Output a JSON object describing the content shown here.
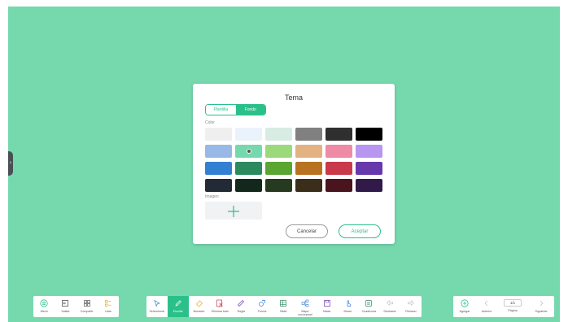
{
  "dialog": {
    "title": "Tema",
    "tabs": [
      "Plantilla",
      "Fondo"
    ],
    "active_tab": "Fondo",
    "color_label": "Color",
    "image_label": "Imagen",
    "cancel_label": "Cancelar",
    "accept_label": "Aceptar",
    "selected_color": "#76d9ae",
    "swatch_colors": [
      [
        "#efefef",
        "#eaf3fb",
        "#d7ece3",
        "#808080",
        "#2f2f2f",
        "#000000"
      ],
      [
        "#98b9e6",
        "#76d9ae",
        "#9cd97a",
        "#e2b283",
        "#ef8ba5",
        "#b795f1"
      ],
      [
        "#337fd2",
        "#2b8a5e",
        "#5ba532",
        "#b9721f",
        "#c8394a",
        "#6738ab"
      ],
      [
        "#222a35",
        "#13281d",
        "#263a1f",
        "#3a2d1a",
        "#4a141e",
        "#311a4a"
      ]
    ]
  },
  "toolbar_left": {
    "items": [
      {
        "label": "Menú",
        "icon": "menu-icon"
      },
      {
        "label": "Salida",
        "icon": "exit-icon"
      },
      {
        "label": "Compartir",
        "icon": "share-icon"
      },
      {
        "label": "Lista",
        "icon": "list-icon"
      }
    ]
  },
  "toolbar_center": {
    "items": [
      {
        "label": "Seleccionar",
        "icon": "select-icon"
      },
      {
        "label": "Escribir",
        "icon": "pen-icon"
      },
      {
        "label": "Borrador",
        "icon": "eraser-icon"
      },
      {
        "label": "Eliminar todo",
        "icon": "clear-all-icon"
      },
      {
        "label": "Regla",
        "icon": "ruler-icon"
      },
      {
        "label": "Forma",
        "icon": "shape-icon"
      },
      {
        "label": "Tabla",
        "icon": "table-icon"
      },
      {
        "label": "Mapa conceptual",
        "icon": "mindmap-icon"
      },
      {
        "label": "Notas",
        "icon": "notes-icon"
      },
      {
        "label": "Mover",
        "icon": "move-icon"
      },
      {
        "label": "Cuadrícula",
        "icon": "grid-icon"
      },
      {
        "label": "Deshacer",
        "icon": "undo-icon"
      },
      {
        "label": "Rehacer",
        "icon": "redo-icon"
      }
    ],
    "active": "Escribir"
  },
  "toolbar_right": {
    "add_label": "Agregar",
    "prev_label": "Anterior",
    "page_label": "Página",
    "page_value": "1/1",
    "next_label": "Siguiente"
  },
  "colors": {
    "canvas": "#76d9ae",
    "accent": "#2bc08a"
  }
}
